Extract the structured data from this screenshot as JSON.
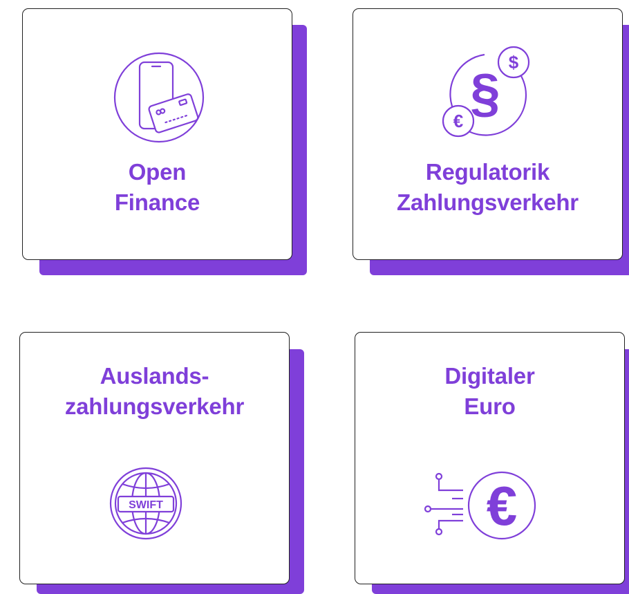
{
  "cards": [
    {
      "title_lines": [
        "Open",
        "Finance"
      ],
      "icon": "phone-card-icon"
    },
    {
      "title_lines": [
        "Regulatorik",
        "Zahlungsverkehr"
      ],
      "icon": "paragraph-currency-icon",
      "icon_text": {
        "dollar": "$",
        "euro": "€",
        "paragraph": "§"
      }
    },
    {
      "title_lines": [
        "Auslands-",
        "zahlungsverkehr"
      ],
      "icon": "swift-globe-icon",
      "icon_text": {
        "label": "SWIFT"
      }
    },
    {
      "title_lines": [
        "Digitaler",
        "Euro"
      ],
      "icon": "digital-euro-icon",
      "icon_text": {
        "euro": "€"
      }
    }
  ],
  "colors": {
    "accent": "#7f3fd9",
    "border": "#1f1f1f",
    "background": "#ffffff"
  }
}
